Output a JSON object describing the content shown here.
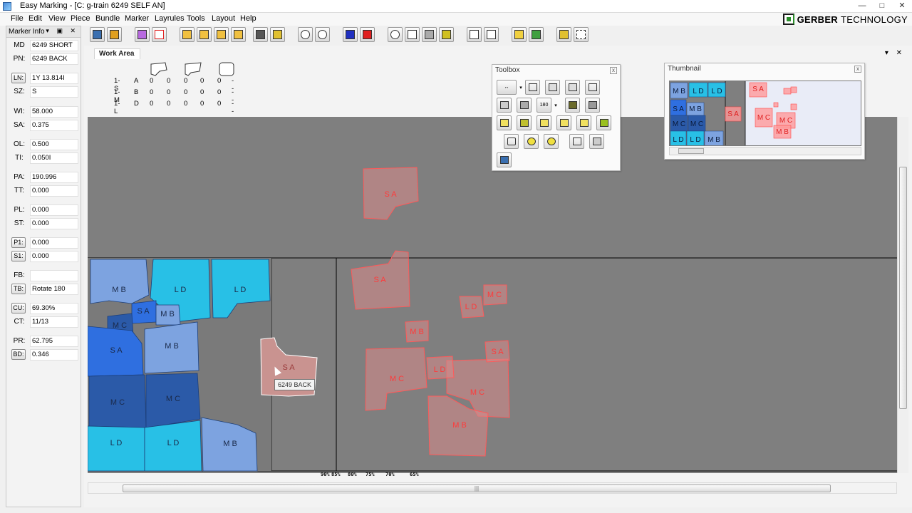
{
  "window": {
    "title": "Easy Marking - [C: g-train 6249 SELF AN]",
    "controls": [
      "—",
      "□",
      "✕"
    ]
  },
  "menus": [
    "File",
    "Edit",
    "View",
    "Piece",
    "Bundle",
    "Marker",
    "Layrules",
    "Tools",
    "Layout",
    "Help"
  ],
  "brand": {
    "name_bold": "GERBER",
    "name_rest": "TECHNOLOGY"
  },
  "marker_info": {
    "title": "Marker Info",
    "controls": "▾ ▣ ✕",
    "fields": [
      {
        "label": "MD",
        "value": "6249 SHORT",
        "button": false
      },
      {
        "label": "PN:",
        "value": "6249 BACK",
        "button": false
      },
      {
        "label": "LN:",
        "value": "1Y 13.814I",
        "button": true
      },
      {
        "label": "SZ:",
        "value": "S",
        "button": false
      },
      {
        "label": "WI:",
        "value": "58.000",
        "button": false
      },
      {
        "label": "SA:",
        "value": "0.375",
        "button": false
      },
      {
        "label": "OL:",
        "value": "0.500",
        "button": false
      },
      {
        "label": "TI:",
        "value": "0.050I",
        "button": false
      },
      {
        "label": "PA:",
        "value": "190.996",
        "button": false
      },
      {
        "label": "TT:",
        "value": "0.000",
        "button": false
      },
      {
        "label": "PL:",
        "value": "0.000",
        "button": false
      },
      {
        "label": "ST:",
        "value": "0.000",
        "button": false
      },
      {
        "label": "P1:",
        "value": "0.000",
        "button": true
      },
      {
        "label": "S1:",
        "value": "0.000",
        "button": true
      },
      {
        "label": "FB:",
        "value": "",
        "button": false
      },
      {
        "label": "TB:",
        "value": "Rotate 180",
        "button": true
      },
      {
        "label": "CU:",
        "value": "69.30%",
        "button": true
      },
      {
        "label": "CT:",
        "value": "11/13",
        "button": false
      },
      {
        "label": "PR:",
        "value": "62.795",
        "button": false
      },
      {
        "label": "BD:",
        "value": "0.346",
        "button": true
      }
    ]
  },
  "workarea": {
    "tab_label": "Work Area",
    "tab_controls": "▾ ✕",
    "counts": [
      {
        "size": "1- S",
        "letter": "A",
        "values": [
          "0",
          "0",
          "0",
          "0",
          "0",
          "--"
        ]
      },
      {
        "size": "1- M",
        "letter": "B",
        "values": [
          "0",
          "0",
          "0",
          "0",
          "0",
          "--"
        ]
      },
      {
        "size": "1- L",
        "letter": "D",
        "values": [
          "0",
          "0",
          "0",
          "0",
          "0",
          "--"
        ]
      }
    ],
    "ruler_labels": [
      "90%",
      "85%",
      "80%",
      "75%",
      "70%",
      "65%"
    ]
  },
  "toolbox": {
    "title": "Toolbox",
    "close": "x"
  },
  "thumbnail": {
    "title": "Thumbnail",
    "close": "x"
  },
  "tooltip": "6249 BACK",
  "pieces": {
    "placed": [
      {
        "label": "M B",
        "color": "#7da3e0"
      },
      {
        "label": "L D",
        "color": "#28c0e6"
      },
      {
        "label": "L D",
        "color": "#28c0e6"
      },
      {
        "label": "S A",
        "color": "#2f6fe0"
      },
      {
        "label": "M B",
        "color": "#7da3e0"
      },
      {
        "label": "M C",
        "color": "#2b5aa8"
      },
      {
        "label": "S A",
        "color": "#2f6fe0"
      },
      {
        "label": "M B",
        "color": "#7da3e0"
      },
      {
        "label": "M C",
        "color": "#2b5aa8"
      },
      {
        "label": "M C",
        "color": "#2b5aa8"
      },
      {
        "label": "L D",
        "color": "#28c0e6"
      },
      {
        "label": "L D",
        "color": "#28c0e6"
      },
      {
        "label": "M B",
        "color": "#7da3e0"
      }
    ],
    "selected": {
      "label": "S A",
      "color": "#c99390"
    },
    "unplaced": [
      {
        "label": "S A"
      },
      {
        "label": "S A"
      },
      {
        "label": "M C"
      },
      {
        "label": "M B"
      },
      {
        "label": "L D"
      },
      {
        "label": "S A"
      },
      {
        "label": "M C"
      },
      {
        "label": "L D"
      },
      {
        "label": "M C"
      },
      {
        "label": "M B"
      }
    ],
    "unplaced_color": "#ff6b6b"
  },
  "thumbnail_pieces": {
    "placed": [
      "M B",
      "L D",
      "L D",
      "S A",
      "M B",
      "M C",
      "M C",
      "L D",
      "L D",
      "M B"
    ],
    "unplaced": [
      "S A",
      "S A",
      "M C",
      "M C",
      "M B"
    ]
  }
}
